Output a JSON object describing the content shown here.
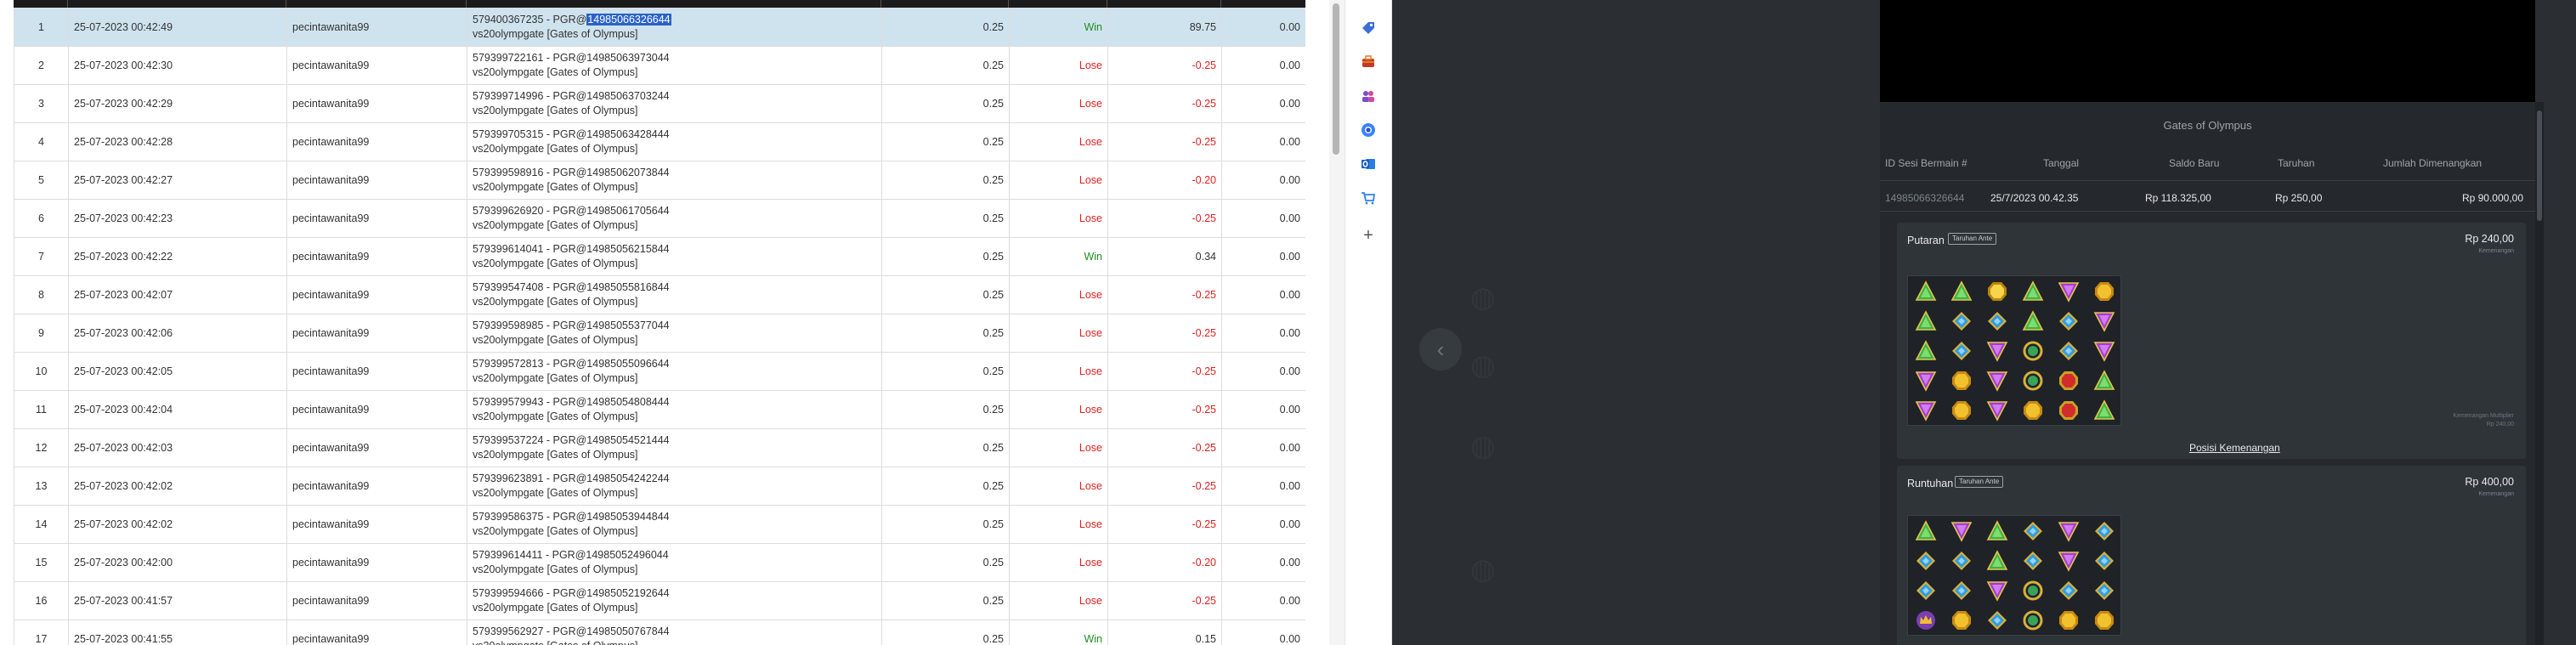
{
  "table": {
    "rows": [
      {
        "no": "1",
        "time": "25-07-2023 00:42:49",
        "user": "pecintawanita99",
        "ref_pre": "579400367235 - PGR@",
        "ref_hl": "14985066326644",
        "ref_line2": "vs20olympgate [Gates of Olympus]",
        "bet": "0.25",
        "result": "Win",
        "winloss": "89.75",
        "extra": "0.00",
        "selected": true
      },
      {
        "no": "2",
        "time": "25-07-2023 00:42:30",
        "user": "pecintawanita99",
        "ref_line1": "579399722161 - PGR@14985063973044",
        "ref_line2": "vs20olympgate [Gates of Olympus]",
        "bet": "0.25",
        "result": "Lose",
        "winloss": "-0.25",
        "extra": "0.00"
      },
      {
        "no": "3",
        "time": "25-07-2023 00:42:29",
        "user": "pecintawanita99",
        "ref_line1": "579399714996 - PGR@14985063703244",
        "ref_line2": "vs20olympgate [Gates of Olympus]",
        "bet": "0.25",
        "result": "Lose",
        "winloss": "-0.25",
        "extra": "0.00"
      },
      {
        "no": "4",
        "time": "25-07-2023 00:42:28",
        "user": "pecintawanita99",
        "ref_line1": "579399705315 - PGR@14985063428444",
        "ref_line2": "vs20olympgate [Gates of Olympus]",
        "bet": "0.25",
        "result": "Lose",
        "winloss": "-0.25",
        "extra": "0.00"
      },
      {
        "no": "5",
        "time": "25-07-2023 00:42:27",
        "user": "pecintawanita99",
        "ref_line1": "579399598916 - PGR@14985062073844",
        "ref_line2": "vs20olympgate [Gates of Olympus]",
        "bet": "0.25",
        "result": "Lose",
        "winloss": "-0.20",
        "extra": "0.00"
      },
      {
        "no": "6",
        "time": "25-07-2023 00:42:23",
        "user": "pecintawanita99",
        "ref_line1": "579399626920 - PGR@14985061705644",
        "ref_line2": "vs20olympgate [Gates of Olympus]",
        "bet": "0.25",
        "result": "Lose",
        "winloss": "-0.25",
        "extra": "0.00"
      },
      {
        "no": "7",
        "time": "25-07-2023 00:42:22",
        "user": "pecintawanita99",
        "ref_line1": "579399614041 - PGR@14985056215844",
        "ref_line2": "vs20olympgate [Gates of Olympus]",
        "bet": "0.25",
        "result": "Win",
        "winloss": "0.34",
        "extra": "0.00"
      },
      {
        "no": "8",
        "time": "25-07-2023 00:42:07",
        "user": "pecintawanita99",
        "ref_line1": "579399547408 - PGR@14985055816844",
        "ref_line2": "vs20olympgate [Gates of Olympus]",
        "bet": "0.25",
        "result": "Lose",
        "winloss": "-0.25",
        "extra": "0.00"
      },
      {
        "no": "9",
        "time": "25-07-2023 00:42:06",
        "user": "pecintawanita99",
        "ref_line1": "579399598985 - PGR@14985055377044",
        "ref_line2": "vs20olympgate [Gates of Olympus]",
        "bet": "0.25",
        "result": "Lose",
        "winloss": "-0.25",
        "extra": "0.00"
      },
      {
        "no": "10",
        "time": "25-07-2023 00:42:05",
        "user": "pecintawanita99",
        "ref_line1": "579399572813 - PGR@14985055096644",
        "ref_line2": "vs20olympgate [Gates of Olympus]",
        "bet": "0.25",
        "result": "Lose",
        "winloss": "-0.25",
        "extra": "0.00"
      },
      {
        "no": "11",
        "time": "25-07-2023 00:42:04",
        "user": "pecintawanita99",
        "ref_line1": "579399579943 - PGR@14985054808444",
        "ref_line2": "vs20olympgate [Gates of Olympus]",
        "bet": "0.25",
        "result": "Lose",
        "winloss": "-0.25",
        "extra": "0.00"
      },
      {
        "no": "12",
        "time": "25-07-2023 00:42:03",
        "user": "pecintawanita99",
        "ref_line1": "579399537224 - PGR@14985054521444",
        "ref_line2": "vs20olympgate [Gates of Olympus]",
        "bet": "0.25",
        "result": "Lose",
        "winloss": "-0.25",
        "extra": "0.00"
      },
      {
        "no": "13",
        "time": "25-07-2023 00:42:02",
        "user": "pecintawanita99",
        "ref_line1": "579399623891 - PGR@14985054242244",
        "ref_line2": "vs20olympgate [Gates of Olympus]",
        "bet": "0.25",
        "result": "Lose",
        "winloss": "-0.25",
        "extra": "0.00"
      },
      {
        "no": "14",
        "time": "25-07-2023 00:42:02",
        "user": "pecintawanita99",
        "ref_line1": "579399586375 - PGR@14985053944844",
        "ref_line2": "vs20olympgate [Gates of Olympus]",
        "bet": "0.25",
        "result": "Lose",
        "winloss": "-0.25",
        "extra": "0.00"
      },
      {
        "no": "15",
        "time": "25-07-2023 00:42:00",
        "user": "pecintawanita99",
        "ref_line1": "579399614411 - PGR@14985052496044",
        "ref_line2": "vs20olympgate [Gates of Olympus]",
        "bet": "0.25",
        "result": "Lose",
        "winloss": "-0.20",
        "extra": "0.00"
      },
      {
        "no": "16",
        "time": "25-07-2023 00:41:57",
        "user": "pecintawanita99",
        "ref_line1": "579399594666 - PGR@14985052192644",
        "ref_line2": "vs20olympgate [Gates of Olympus]",
        "bet": "0.25",
        "result": "Lose",
        "winloss": "-0.25",
        "extra": "0.00"
      },
      {
        "no": "17",
        "time": "25-07-2023 00:41:55",
        "user": "pecintawanita99",
        "ref_line1": "579399562927 - PGR@14985050767844",
        "ref_line2": "vs20olympgate [Gates of Olympus]",
        "bet": "0.25",
        "result": "Win",
        "winloss": "0.15",
        "extra": "0.00"
      }
    ]
  },
  "extensions": [
    "tag-icon",
    "briefcase-icon",
    "people-icon",
    "chrome-icon",
    "outlook-icon",
    "cart-icon",
    "plus-icon"
  ],
  "game": {
    "title": "Gates of Olympus",
    "headers": {
      "session": "ID Sesi Bermain #",
      "date": "Tanggal",
      "balance": "Saldo Baru",
      "bet": "Taruhan",
      "win": "Jumlah Dimenangkan"
    },
    "values": {
      "session": "14985066326644",
      "date": "25/7/2023 00.42.35",
      "balance": "Rp 118.325,00",
      "bet": "Rp 250,00",
      "win": "Rp 90.000,00"
    },
    "putaran": {
      "title": "Putaran",
      "badge": "Taruhan Ante",
      "amount": "Rp 240,00",
      "amount_sub": "Kemenangan",
      "note_line1": "Kemenangan Multiplier",
      "note_line2": "Rp 240,00",
      "link": "Posisi Kemenangan",
      "grid": [
        [
          "green-tri",
          "green-tri",
          "yellow-gem",
          "green-tri",
          "purple-tri",
          "gold-gem"
        ],
        [
          "green-tri",
          "blue-gem",
          "blue-gem",
          "green-tri",
          "blue-gem",
          "purple-tri"
        ],
        [
          "green-tri",
          "blue-gem",
          "purple-tri",
          "ring",
          "blue-gem",
          "purple-tri"
        ],
        [
          "purple-tri",
          "gold-gem",
          "purple-tri",
          "ring",
          "red-gem",
          "green-tri"
        ],
        [
          "purple-tri",
          "gold-gem",
          "purple-tri",
          "gold-gem",
          "red-gem",
          "green-tri"
        ]
      ]
    },
    "runtuhan": {
      "title": "Runtuhan",
      "badge": "Taruhan Ante",
      "amount": "Rp 400,00",
      "amount_sub": "Kemenangan",
      "grid": [
        [
          "green-tri",
          "purple-tri",
          "green-tri",
          "blue-gem",
          "purple-tri",
          "blue-gem"
        ],
        [
          "blue-gem",
          "blue-gem",
          "green-tri",
          "blue-gem",
          "purple-tri",
          "blue-gem"
        ],
        [
          "blue-gem",
          "blue-gem",
          "purple-tri",
          "ring",
          "blue-gem",
          "blue-gem"
        ],
        [
          "crown",
          "gold-gem",
          "blue-gem",
          "ring",
          "gold-gem",
          "gold-gem"
        ]
      ]
    }
  }
}
